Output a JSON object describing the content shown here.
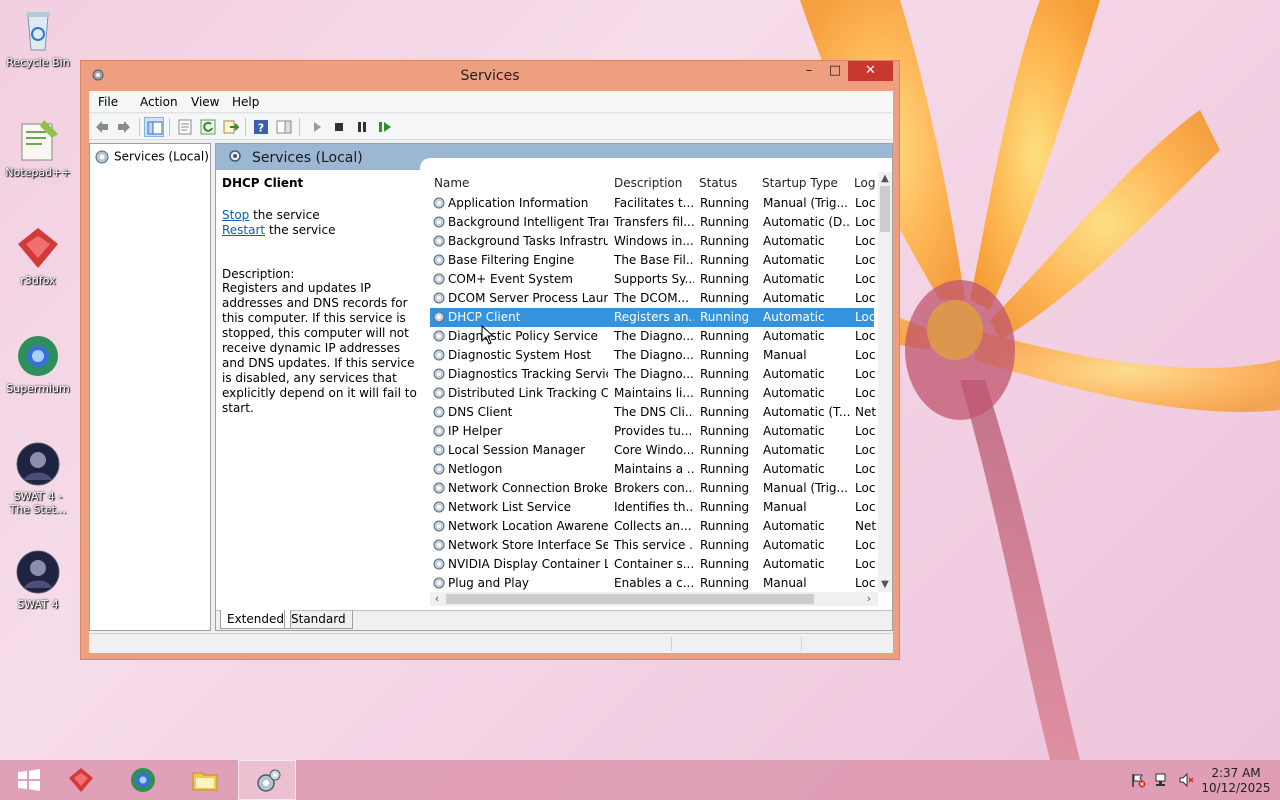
{
  "desktop": {
    "icons": [
      {
        "label": "Recycle Bin",
        "icon": "recycle-bin-icon"
      },
      {
        "label": "Notepad++",
        "icon": "notepadpp-icon"
      },
      {
        "label": "r3dfox",
        "icon": "r3dfox-icon"
      },
      {
        "label": "Supermium",
        "icon": "supermium-icon"
      },
      {
        "label": "SWAT 4 - The Stet...",
        "icon": "swat4-stetchkov-icon"
      },
      {
        "label": "SWAT 4",
        "icon": "swat4-icon"
      }
    ]
  },
  "window": {
    "title": "Services",
    "controls": {
      "minimize": "–",
      "maximize": "□",
      "close": "✕"
    }
  },
  "menu": [
    "File",
    "Action",
    "View",
    "Help"
  ],
  "tree": {
    "root": "Services (Local)"
  },
  "main": {
    "header_title": "Services (Local)",
    "selected_service": "DHCP Client",
    "stop_link": "Stop",
    "stop_suffix": " the service",
    "restart_link": "Restart",
    "restart_suffix": " the service",
    "description_label": "Description:",
    "description": "Registers and updates IP addresses and DNS records for this computer. If this service is stopped, this computer will not receive dynamic IP addresses and DNS updates. If this service is disabled, any services that explicitly depend on it will fail to start."
  },
  "columns": {
    "name": "Name",
    "description": "Description",
    "status": "Status",
    "startup": "Startup Type",
    "log": "Log"
  },
  "services": [
    {
      "name": "Application Information",
      "description": "Facilitates t...",
      "status": "Running",
      "startup": "Manual (Trig...",
      "log": "Loc"
    },
    {
      "name": "Background Intelligent Tran...",
      "description": "Transfers fil...",
      "status": "Running",
      "startup": "Automatic (D...",
      "log": "Loc"
    },
    {
      "name": "Background Tasks Infrastru...",
      "description": "Windows in...",
      "status": "Running",
      "startup": "Automatic",
      "log": "Loc"
    },
    {
      "name": "Base Filtering Engine",
      "description": "The Base Fil...",
      "status": "Running",
      "startup": "Automatic",
      "log": "Loc"
    },
    {
      "name": "COM+ Event System",
      "description": "Supports Sy...",
      "status": "Running",
      "startup": "Automatic",
      "log": "Loc"
    },
    {
      "name": "DCOM Server Process Laun...",
      "description": "The DCOM...",
      "status": "Running",
      "startup": "Automatic",
      "log": "Loc"
    },
    {
      "name": "DHCP Client",
      "description": "Registers an...",
      "status": "Running",
      "startup": "Automatic",
      "log": "Loc",
      "selected": true
    },
    {
      "name": "Diagnostic Policy Service",
      "description": "The Diagno...",
      "status": "Running",
      "startup": "Automatic",
      "log": "Loc"
    },
    {
      "name": "Diagnostic System Host",
      "description": "The Diagno...",
      "status": "Running",
      "startup": "Manual",
      "log": "Loc"
    },
    {
      "name": "Diagnostics Tracking Service",
      "description": "The Diagno...",
      "status": "Running",
      "startup": "Automatic",
      "log": "Loc"
    },
    {
      "name": "Distributed Link Tracking Cl...",
      "description": "Maintains li...",
      "status": "Running",
      "startup": "Automatic",
      "log": "Loc"
    },
    {
      "name": "DNS Client",
      "description": "The DNS Cli...",
      "status": "Running",
      "startup": "Automatic (T...",
      "log": "Net"
    },
    {
      "name": "IP Helper",
      "description": "Provides tu...",
      "status": "Running",
      "startup": "Automatic",
      "log": "Loc"
    },
    {
      "name": "Local Session Manager",
      "description": "Core Windo...",
      "status": "Running",
      "startup": "Automatic",
      "log": "Loc"
    },
    {
      "name": "Netlogon",
      "description": "Maintains a ...",
      "status": "Running",
      "startup": "Automatic",
      "log": "Loc"
    },
    {
      "name": "Network Connection Broker",
      "description": "Brokers con...",
      "status": "Running",
      "startup": "Manual (Trig...",
      "log": "Loc"
    },
    {
      "name": "Network List Service",
      "description": "Identifies th...",
      "status": "Running",
      "startup": "Manual",
      "log": "Loc"
    },
    {
      "name": "Network Location Awareness",
      "description": "Collects an...",
      "status": "Running",
      "startup": "Automatic",
      "log": "Net"
    },
    {
      "name": "Network Store Interface Ser...",
      "description": "This service ...",
      "status": "Running",
      "startup": "Automatic",
      "log": "Loc"
    },
    {
      "name": "NVIDIA Display Container LS",
      "description": "Container s...",
      "status": "Running",
      "startup": "Automatic",
      "log": "Loc"
    },
    {
      "name": "Plug and Play",
      "description": "Enables a c...",
      "status": "Running",
      "startup": "Manual",
      "log": "Loc"
    }
  ],
  "tabs": [
    {
      "label": "Extended",
      "active": true
    },
    {
      "label": "Standard",
      "active": false
    }
  ],
  "taskbar": {
    "items": [
      {
        "icon": "start-windows-icon"
      },
      {
        "icon": "r3dfox-icon"
      },
      {
        "icon": "supermium-icon"
      },
      {
        "icon": "file-explorer-icon"
      },
      {
        "icon": "services-gear-icon",
        "active": true
      }
    ],
    "clock_time": "2:37 AM",
    "clock_date": "10/12/2025"
  },
  "colors": {
    "window_frame": "#ee9f80",
    "selection": "#3393df",
    "header_band": "#9cb7d4",
    "close_button": "#c8382d",
    "link": "#0f5fb4"
  }
}
